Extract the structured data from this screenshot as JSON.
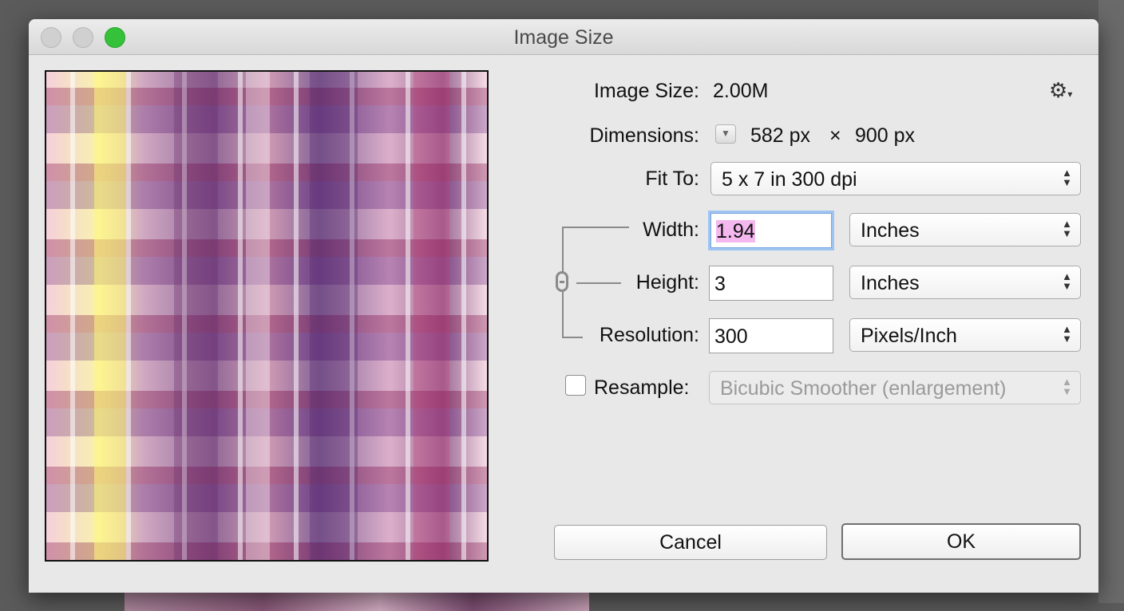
{
  "window": {
    "title": "Image Size"
  },
  "image_size": {
    "label": "Image Size:",
    "value": "2.00M"
  },
  "dimensions": {
    "label": "Dimensions:",
    "width": "582 px",
    "times": "×",
    "height": "900 px"
  },
  "fit_to": {
    "label": "Fit To:",
    "value": "5 x 7 in 300 dpi"
  },
  "width": {
    "label": "Width:",
    "value": "1.94",
    "unit": "Inches"
  },
  "height": {
    "label": "Height:",
    "value": "3",
    "unit": "Inches"
  },
  "resolution": {
    "label": "Resolution:",
    "value": "300",
    "unit": "Pixels/Inch"
  },
  "resample": {
    "label": "Resample:",
    "checked": false,
    "method": "Bicubic Smoother (enlargement)"
  },
  "buttons": {
    "cancel": "Cancel",
    "ok": "OK"
  },
  "icons": {
    "settings": "gear-icon",
    "link": "chain-link-icon",
    "disclosure": "disclosure-triangle-icon"
  },
  "colors": {
    "zoom": "#35c13a",
    "selection": "#f4b7ee",
    "focus_ring": "#9ec4f2"
  }
}
